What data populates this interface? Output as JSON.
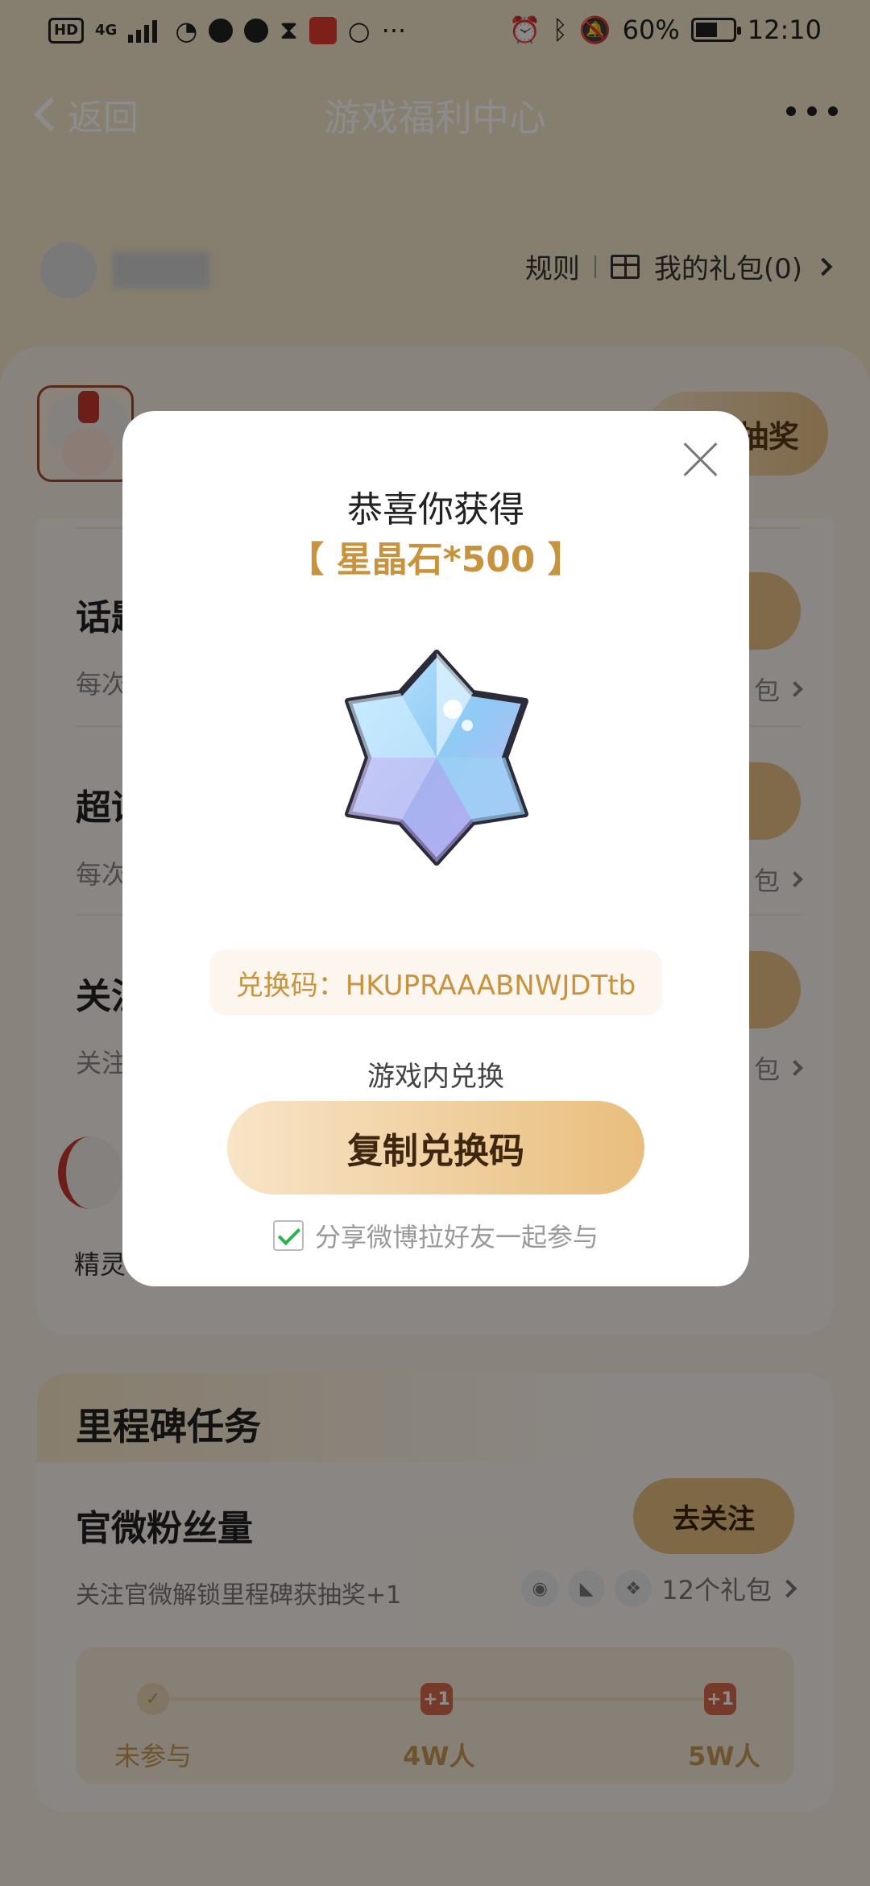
{
  "status_bar": {
    "left_tags": [
      "HD",
      "4G"
    ],
    "battery": "60%",
    "time": "12:10",
    "more": "···"
  },
  "nav": {
    "back_label": "返回",
    "title": "游戏福利中心"
  },
  "header": {
    "rules_label": "规则",
    "my_gifts_label": "我的礼包(0)"
  },
  "game": {
    "lottery_button": "抽奖"
  },
  "tasks": [
    {
      "title": "话题",
      "desc": "每次",
      "link": "包"
    },
    {
      "title": "超话",
      "desc": "每次",
      "link": "包"
    },
    {
      "title": "关注",
      "desc": "关注",
      "link": "包"
    }
  ],
  "character_name": "精灵",
  "milestone": {
    "section_title": "里程碑任务",
    "task_title": "官微粉丝量",
    "button": "去关注",
    "desc": "关注官微解锁里程碑获抽奖+1",
    "gift_count": "12个礼包",
    "nodes": [
      {
        "badge": "✓",
        "label": "未参与"
      },
      {
        "badge": "+1",
        "label": "4W人"
      },
      {
        "badge": "+1",
        "label": "5W人"
      }
    ]
  },
  "modal": {
    "title": "恭喜你获得",
    "prize": "【 星晶石*500 】",
    "code_text": "兑换码：HKUPRAAABNWJDTtb",
    "redeem_hint": "游戏内兑换",
    "copy_button": "复制兑换码",
    "share_label": "分享微博拉好友一起参与",
    "share_checked": true
  },
  "colors": {
    "accent_gold": "#c8933e",
    "button_gold": "#e9be7d",
    "check_green": "#2bb24c"
  }
}
